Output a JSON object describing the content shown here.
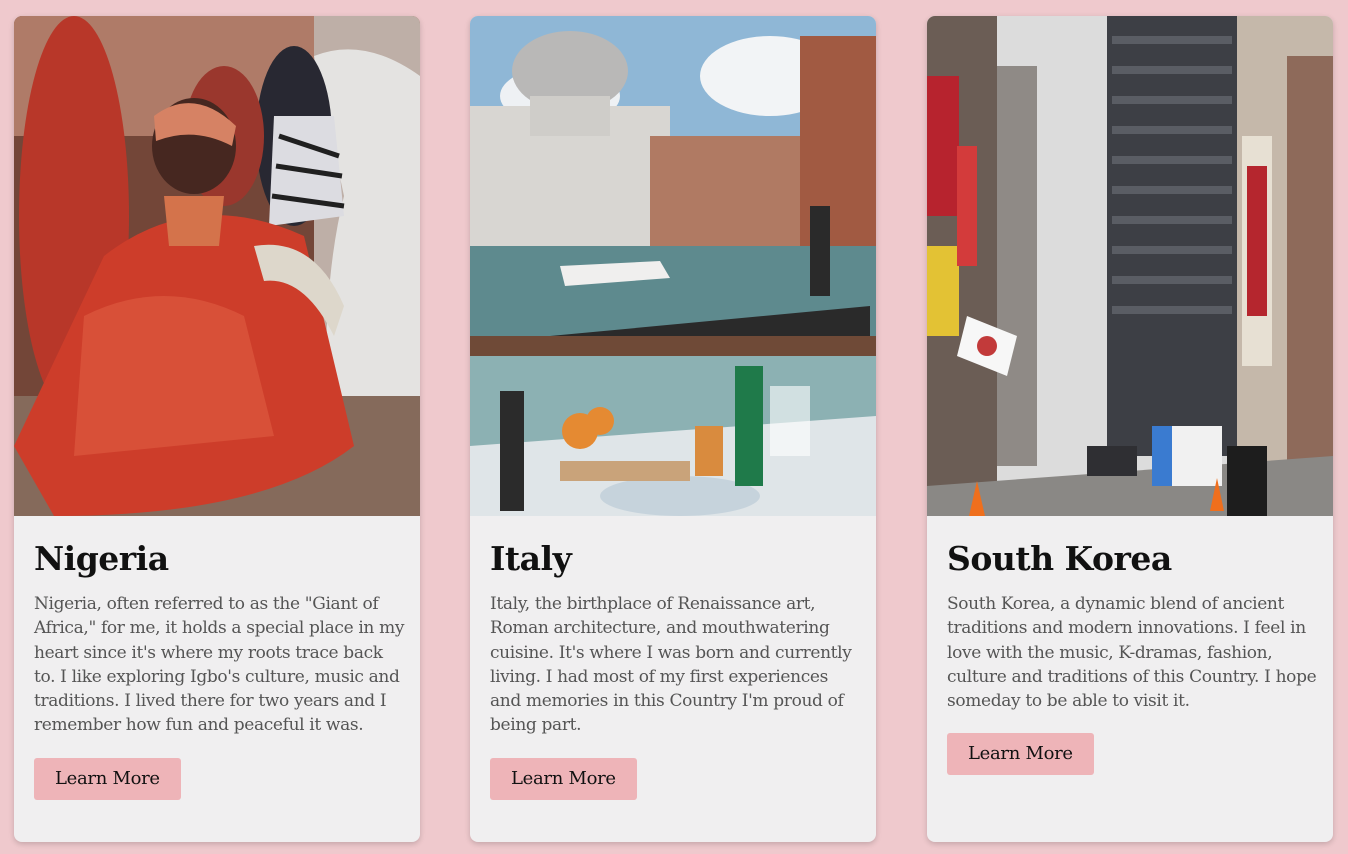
{
  "cards": [
    {
      "title": "Nigeria",
      "description": "Nigeria, often referred to as the \"Giant of Africa,\" for me, it holds a special place in my heart since it's where my roots trace back to. I like exploring Igbo's culture, music and traditions. I lived there for two years and I remember how fun and peaceful it was.",
      "button_label": "Learn More",
      "image_alt": "woman in red traditional dress dancing"
    },
    {
      "title": "Italy",
      "description": "Italy, the birthplace of Renaissance art, Roman architecture, and mouthwatering cuisine. It's where I was born and currently living. I had most of my first experiences and memories in this Country I'm proud of being part.",
      "button_label": "Learn More",
      "image_alt": "Venice canal with basilica dome and aperitivo table"
    },
    {
      "title": "South Korea",
      "description": "South Korea, a dynamic blend of ancient traditions and modern innovations. I feel in love with the music, K-dramas, fashion, culture and traditions of this Country. I hope someday to be able to visit it.",
      "button_label": "Learn More",
      "image_alt": "Seoul street with signs and Korean flags"
    }
  ],
  "colors": {
    "page_background": "#efc9cd",
    "card_background": "#f0eff0",
    "button_background": "#eeb4b8",
    "title_text": "#111111",
    "body_text": "#555555"
  }
}
